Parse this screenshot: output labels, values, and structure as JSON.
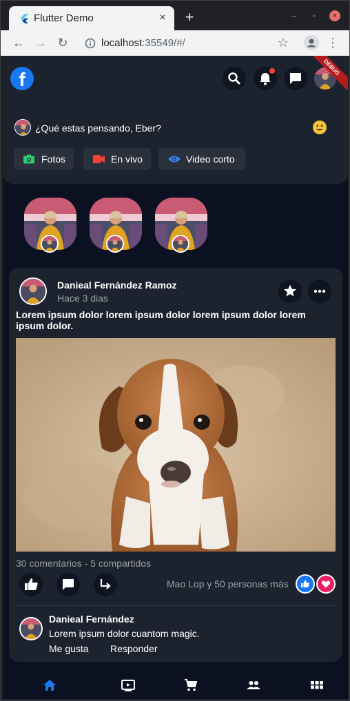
{
  "browser": {
    "tab_title": "Flutter Demo",
    "tab_close": "×",
    "new_tab": "+",
    "url_host": "localhost",
    "url_rest": ":35549/#/"
  },
  "header": {
    "logo": "f",
    "debug_banner": "DEBUG"
  },
  "composer": {
    "prompt": "¿Qué estas pensando, Eber?",
    "buttons": [
      {
        "label": "Fotos",
        "icon": "camera-icon",
        "color": "#2ecc71"
      },
      {
        "label": "En vivo",
        "icon": "video-camera-icon",
        "color": "#f44336"
      },
      {
        "label": "Video corto",
        "icon": "eye-icon",
        "color": "#3b82f6"
      }
    ]
  },
  "stories": {
    "count": 3
  },
  "post": {
    "author": "Danieal Fernández Ramoz",
    "time": "Hace 3 dias",
    "text": "Lorem ipsum dolor lorem ipsum dolor lorem ipsum dolor lorem ipsum dolor.",
    "stats": "30 comentarios - 5 compartidos",
    "likers": "Mao Lop y 50 personas más",
    "like_color": "#1877f2",
    "love_color": "#e91e63"
  },
  "comment": {
    "author": "Danieal Fernández",
    "text": "Lorem ipsum dolor cuantom magic.",
    "like_action": "Me gusta",
    "reply_action": "Responder"
  },
  "bottom_nav": {
    "active_color": "#1877f2",
    "items": [
      "home-icon",
      "video-icon",
      "cart-icon",
      "people-icon",
      "grid-icon"
    ]
  }
}
